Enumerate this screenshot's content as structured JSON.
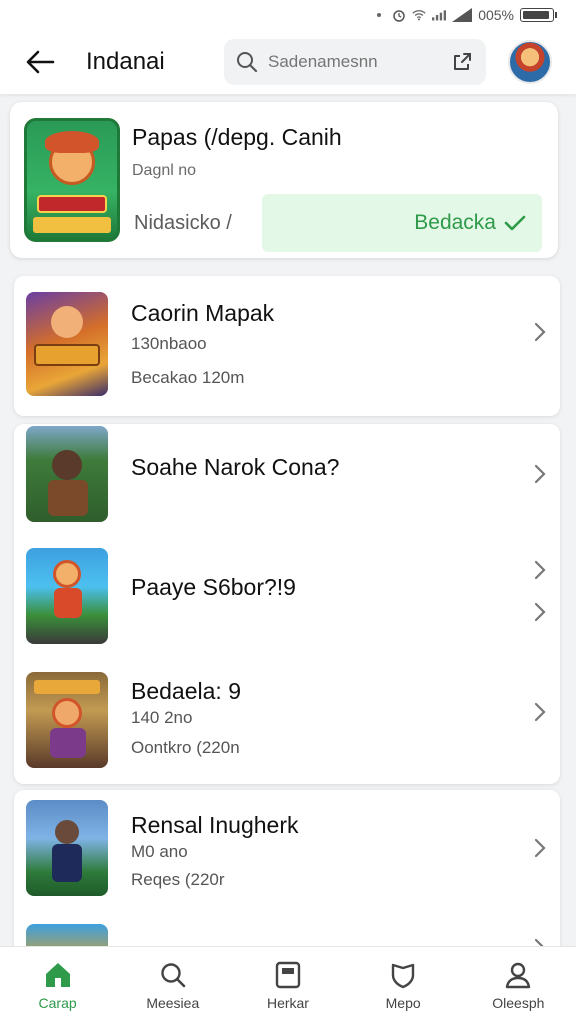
{
  "status_bar": {
    "battery_text": "005%"
  },
  "header": {
    "title": "Indanai",
    "search_placeholder": "Sadenamesnn"
  },
  "featured": {
    "title": "Papas (/depg. Canih",
    "subtitle": "Dagnl no",
    "meta": "Nidasicko /",
    "installed_label": "Bedacka",
    "installed_icon": "check-icon",
    "accent_color": "#2e9a4a"
  },
  "games": [
    {
      "title": "Caorin Mapak",
      "subtitle": "130nbaoo",
      "meta": "Becakao 120m"
    },
    {
      "title": "Soahe Narok Cona?",
      "subtitle": "",
      "meta": ""
    },
    {
      "title": "Paaye S6bor?!9",
      "subtitle": "",
      "meta": ""
    },
    {
      "title": "Bedaela: 9",
      "subtitle": "140 2no",
      "meta": "Oontkro (220n"
    },
    {
      "title": "Rensal Inugherk",
      "subtitle": "M0 ano",
      "meta": "Reqes (220r"
    }
  ],
  "bottom_nav": [
    {
      "label": "Carap",
      "icon": "home-icon",
      "active": true
    },
    {
      "label": "Meesiea",
      "icon": "search-icon",
      "active": false
    },
    {
      "label": "Herkar",
      "icon": "library-icon",
      "active": false
    },
    {
      "label": "Mepo",
      "icon": "shield-icon",
      "active": false
    },
    {
      "label": "Oleesph",
      "icon": "person-icon",
      "active": false
    }
  ]
}
